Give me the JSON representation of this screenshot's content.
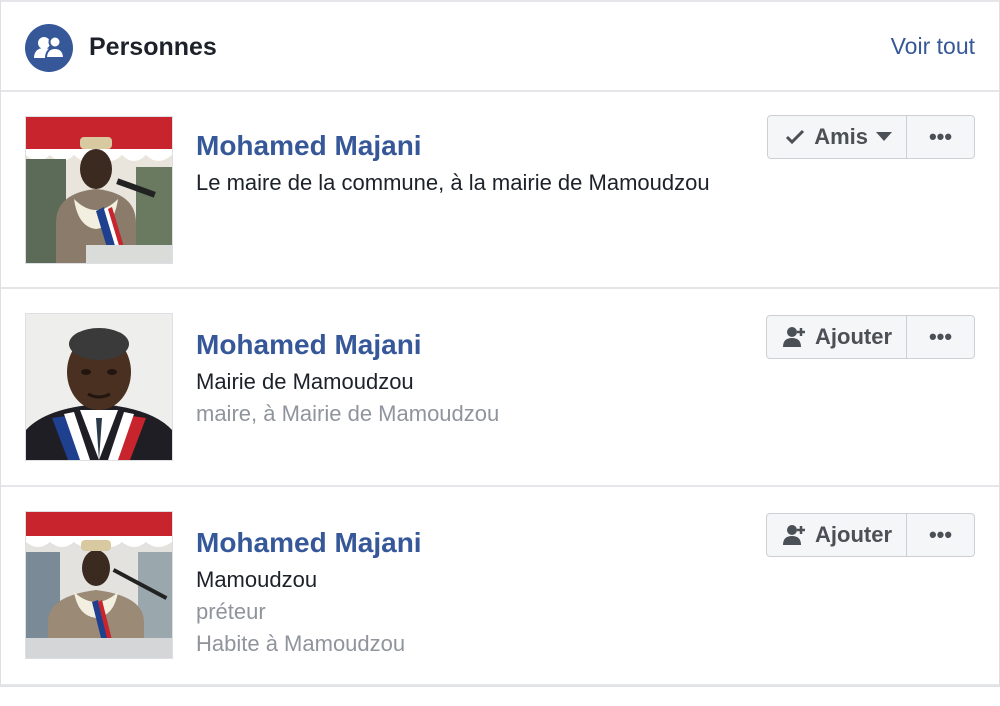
{
  "header": {
    "title": "Personnes",
    "see_all": "Voir tout",
    "icon": "people-icon"
  },
  "colors": {
    "link": "#365899",
    "text": "#1d2129",
    "muted": "#90949c",
    "button_bg": "#f5f6f7",
    "button_border": "#ccd0d5"
  },
  "results": [
    {
      "name": "Mohamed Majani",
      "lines": [
        "Le maire de la commune, à la mairie de Mamoudzou"
      ],
      "action": {
        "label": "Amis",
        "icon": "checkmark-icon",
        "has_dropdown": true
      },
      "more_label": "•••"
    },
    {
      "name": "Mohamed Majani",
      "lines": [
        "Mairie de Mamoudzou",
        "maire, à Mairie de Mamoudzou"
      ],
      "action": {
        "label": "Ajouter",
        "icon": "add-friend-icon",
        "has_dropdown": false
      },
      "more_label": "•••"
    },
    {
      "name": "Mohamed Majani",
      "lines": [
        "Mamoudzou",
        "préteur",
        "Habite à Mamoudzou"
      ],
      "action": {
        "label": "Ajouter",
        "icon": "add-friend-icon",
        "has_dropdown": false
      },
      "more_label": "•••"
    }
  ]
}
